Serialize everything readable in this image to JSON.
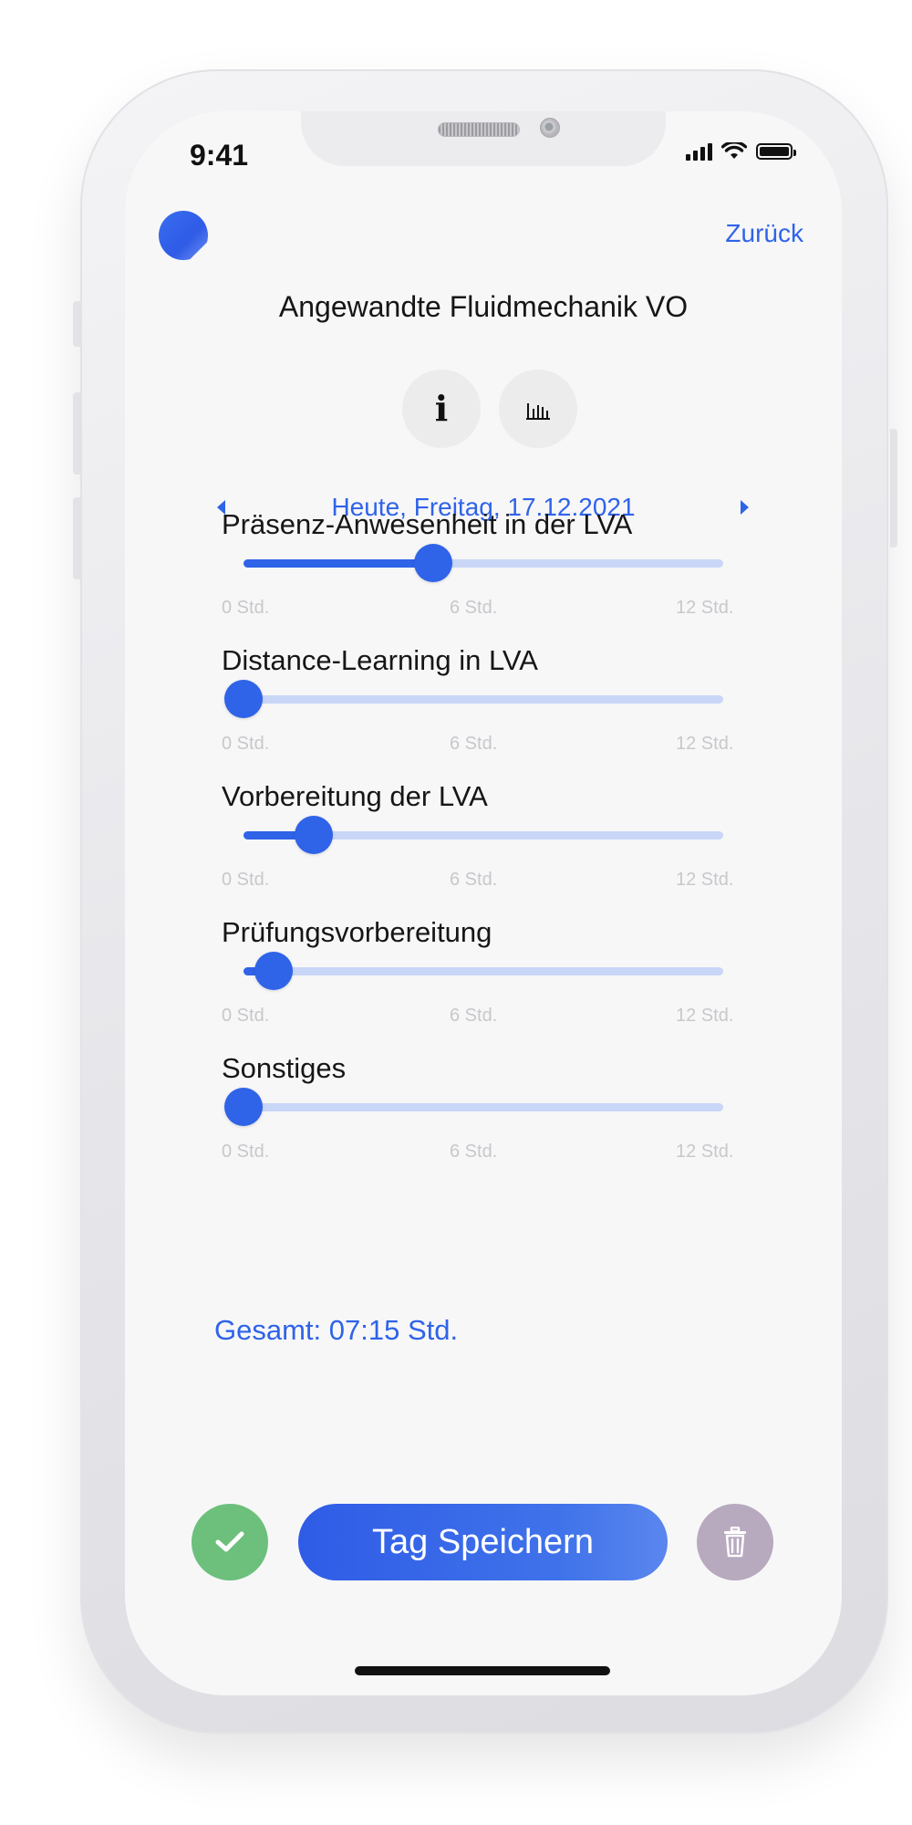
{
  "status_bar": {
    "time": "9:41"
  },
  "header": {
    "back_label": "Zurück"
  },
  "course": {
    "title": "Angewandte Fluidmechanik VO"
  },
  "icons": {
    "info": "info-icon",
    "stats": "bar-chart-icon",
    "confirm": "checkmark-icon",
    "delete": "trash-icon"
  },
  "date_nav": {
    "label": "Heute, Freitag, 17.12.2021"
  },
  "scale": {
    "min_label": "0 Std.",
    "mid_label": "6 Std.",
    "max_label": "12 Std.",
    "max_hours": 12
  },
  "activities": [
    {
      "label": "Präsenz-Anwesenheit in der LVA",
      "hours": 4.75
    },
    {
      "label": "Distance-Learning in LVA",
      "hours": 0
    },
    {
      "label": "Vorbereitung der LVA",
      "hours": 1.75
    },
    {
      "label": "Prüfungsvorbereitung",
      "hours": 0.75
    },
    {
      "label": "Sonstiges",
      "hours": 0
    }
  ],
  "total": {
    "label": "Gesamt: 07:15 Std."
  },
  "actions": {
    "save_label": "Tag Speichern"
  },
  "colors": {
    "accent": "#2f63e8",
    "track": "#c9d6f7",
    "confirm": "#6cc07c",
    "delete": "#b7a9be"
  }
}
